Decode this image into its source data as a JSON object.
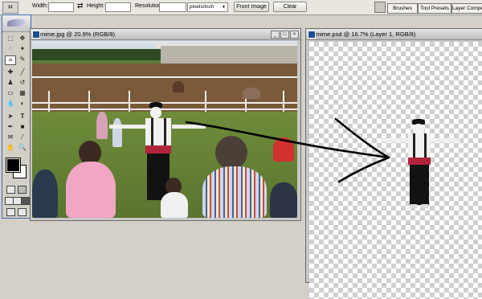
{
  "options_bar": {
    "width_label": "Width:",
    "width_value": "",
    "height_label": "Height:",
    "height_value": "",
    "resolution_label": "Resolution:",
    "resolution_value": "",
    "resolution_unit": "pixels/inch",
    "front_image_button": "Front Image",
    "clear_button": "Clear",
    "crop_tool_icon": "crop-icon",
    "swap_icon": "swap-icon"
  },
  "palette_well": {
    "tabs": [
      "Brushes",
      "Tool Presets",
      "Layer Compe"
    ]
  },
  "toolbox": {
    "tool_icons": [
      "marquee",
      "move",
      "lasso",
      "magic-wand",
      "crop",
      "slice",
      "healing",
      "brush",
      "stamp",
      "history-brush",
      "eraser",
      "gradient",
      "blur",
      "dodge",
      "path-select",
      "type",
      "pen",
      "shape",
      "notes",
      "eyedropper",
      "hand",
      "zoom"
    ],
    "foreground_color": "#000000",
    "background_color": "#ffffff"
  },
  "windows": [
    {
      "title": "mime.jpg @ 20.9% (RGB/8)"
    },
    {
      "title": "mime.psd @ 16.7% (Layer 1, RGB/8)"
    }
  ],
  "colors": {
    "app_bg": "#d4d0c8",
    "accent_border": "#3f6bb5",
    "sash_red": "#b0243a"
  }
}
